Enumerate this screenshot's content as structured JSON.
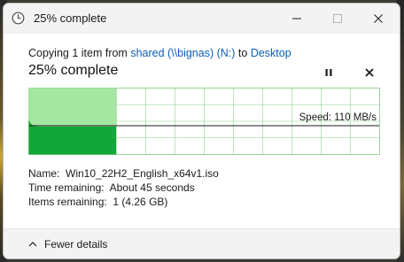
{
  "window": {
    "title": "25% complete",
    "icons": {
      "app": "clock-icon",
      "minimize": "minimize-icon",
      "maximize": "maximize-icon",
      "close": "close-icon"
    }
  },
  "operation": {
    "prefix": "Copying 1 item from ",
    "source": "shared (\\\\bignas) (N:)",
    "connector": " to ",
    "destination": "Desktop",
    "percent_heading": "25% complete",
    "progress": 0.25,
    "pause_icon": "pause-icon",
    "cancel_icon": "close-icon"
  },
  "speed": {
    "label": "Speed: 110 MB/s"
  },
  "details": {
    "name_label": "Name:",
    "name_value": "Win10_22H2_English_x64v1.iso",
    "time_label": "Time remaining:",
    "time_value": "About 45 seconds",
    "items_label": "Items remaining:",
    "items_value": "1 (4.26 GB)"
  },
  "footer": {
    "toggle_label": "Fewer details",
    "toggle_icon": "chevron-up-icon"
  },
  "colors": {
    "completed_fill": "#a6e6a3",
    "throughput_fill": "#11a73a",
    "grid": "#8fd18b",
    "accent_link": "#0a5eb5"
  }
}
